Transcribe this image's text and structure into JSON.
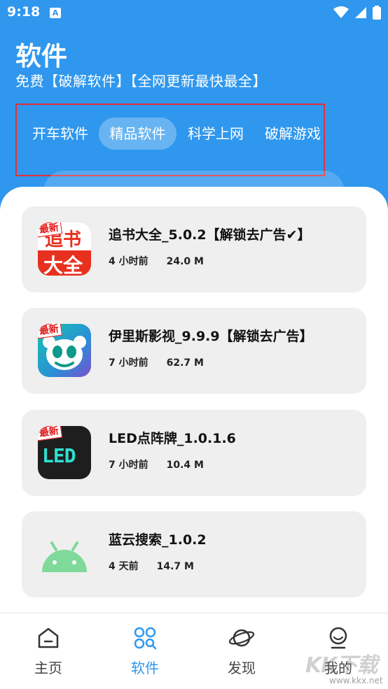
{
  "status": {
    "time": "9:18",
    "notif": "A"
  },
  "header": {
    "title": "软件",
    "subtitle": "免费【破解软件】【全网更新最快最全】"
  },
  "tabs": [
    {
      "label": "开车软件",
      "active": false
    },
    {
      "label": "精品软件",
      "active": true
    },
    {
      "label": "科学上网",
      "active": false
    },
    {
      "label": "破解游戏",
      "active": false
    }
  ],
  "apps": [
    {
      "title": "追书大全_5.0.2【解锁去广告✔】",
      "time": "4 小时前",
      "size": "24.0 M",
      "icon": "book-app-icon",
      "badge": "最新",
      "icon_text_1": "追书",
      "icon_text_2": "大全"
    },
    {
      "title": "伊里斯影视_9.9.9【解锁去广告】",
      "time": "7 小时前",
      "size": "62.7 M",
      "icon": "panda-app-icon",
      "badge": "最新"
    },
    {
      "title": "LED点阵牌_1.0.1.6",
      "time": "7 小时前",
      "size": "10.4 M",
      "icon": "led-app-icon",
      "badge": "最新",
      "icon_text_1": "LED"
    },
    {
      "title": "蓝云搜索_1.0.2",
      "time": "4 天前",
      "size": "14.7 M",
      "icon": "android-app-icon"
    }
  ],
  "nav": [
    {
      "label": "主页",
      "icon": "home-icon",
      "active": false
    },
    {
      "label": "软件",
      "icon": "apps-grid-icon",
      "active": true
    },
    {
      "label": "发现",
      "icon": "planet-icon",
      "active": false
    },
    {
      "label": "我的",
      "icon": "profile-icon",
      "active": false
    }
  ],
  "watermark": {
    "text": "KK下载",
    "site": "www.kkx.net"
  },
  "colors": {
    "primary": "#2f97ee",
    "highlight_border": "#e0313a",
    "card": "#efefef"
  }
}
